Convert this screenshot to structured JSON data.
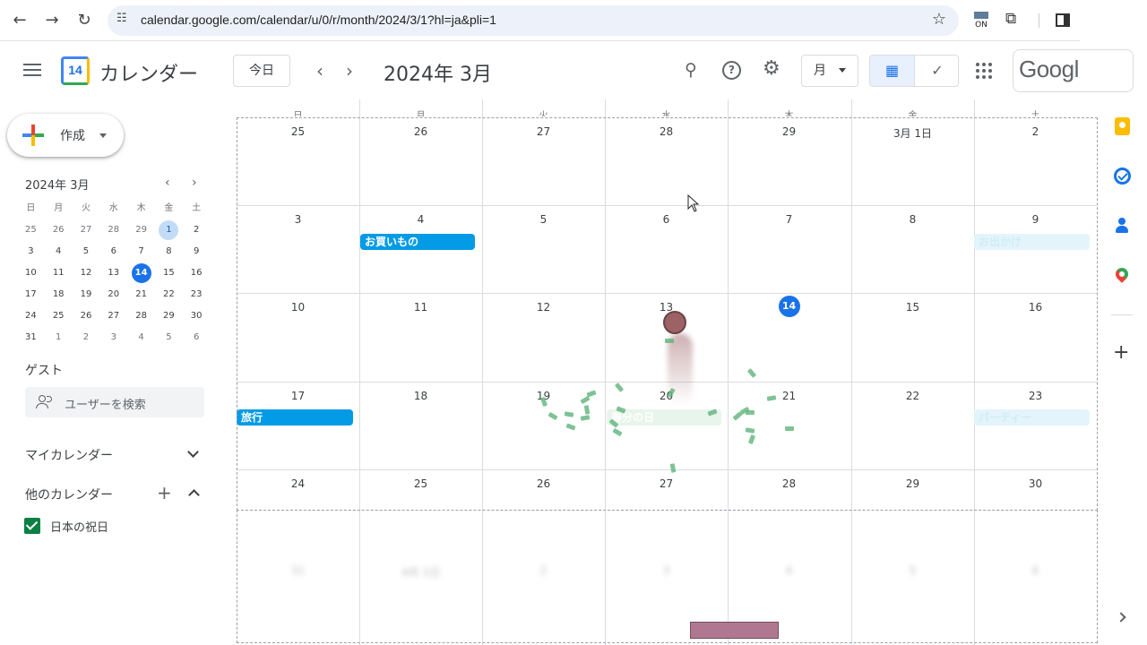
{
  "browser": {
    "url": "calendar.google.com/calendar/u/0/r/month/2024/3/1?hl=ja&pli=1",
    "extension_on_label": "ON"
  },
  "header": {
    "app_name": "カレンダー",
    "logo_day": "14",
    "today_label": "今日",
    "month_title": "2024年 3月",
    "view_label": "月",
    "google_label": "Googl"
  },
  "sidebar": {
    "create_label": "作成",
    "mini_calendar": {
      "title": "2024年 3月",
      "weekdays": [
        "日",
        "月",
        "火",
        "水",
        "木",
        "金",
        "土"
      ],
      "weeks": [
        [
          "25",
          "26",
          "27",
          "28",
          "29",
          "1",
          "2"
        ],
        [
          "3",
          "4",
          "5",
          "6",
          "7",
          "8",
          "9"
        ],
        [
          "10",
          "11",
          "12",
          "13",
          "14",
          "15",
          "16"
        ],
        [
          "17",
          "18",
          "19",
          "20",
          "21",
          "22",
          "23"
        ],
        [
          "24",
          "25",
          "26",
          "27",
          "28",
          "29",
          "30"
        ],
        [
          "31",
          "1",
          "2",
          "3",
          "4",
          "5",
          "6"
        ]
      ]
    },
    "guest_title": "ゲスト",
    "guest_placeholder": "ユーザーを検索",
    "my_calendars_title": "マイカレンダー",
    "other_calendars_title": "他のカレンダー",
    "other_calendars": [
      {
        "label": "日本の祝日",
        "color": "#0b8043",
        "checked": true
      }
    ]
  },
  "month_grid": {
    "weekdays": [
      "日",
      "月",
      "火",
      "水",
      "木",
      "金",
      "土"
    ],
    "weeks": [
      [
        "25",
        "26",
        "27",
        "28",
        "29",
        "3月 1日",
        "2"
      ],
      [
        "3",
        "4",
        "5",
        "6",
        "7",
        "8",
        "9"
      ],
      [
        "10",
        "11",
        "12",
        "13",
        "14",
        "15",
        "16"
      ],
      [
        "17",
        "18",
        "19",
        "20",
        "21",
        "22",
        "23"
      ],
      [
        "24",
        "25",
        "26",
        "27",
        "28",
        "29",
        "30"
      ]
    ],
    "today": "14",
    "events": [
      {
        "label": "お買いもの",
        "style": "blue"
      },
      {
        "label": "お出かけ",
        "style": "faint"
      },
      {
        "label": "旅行",
        "style": "blue"
      },
      {
        "label": "春分の日",
        "style": "faintgreen"
      },
      {
        "label": "パーティー",
        "style": "faint"
      }
    ],
    "blurred_row": [
      "31",
      "4月 1日",
      "2",
      "3",
      "4",
      "5",
      "6"
    ]
  },
  "colors": {
    "accent": "#1a73e8",
    "event_blue": "#039be5",
    "holiday_green": "#0b8043"
  }
}
